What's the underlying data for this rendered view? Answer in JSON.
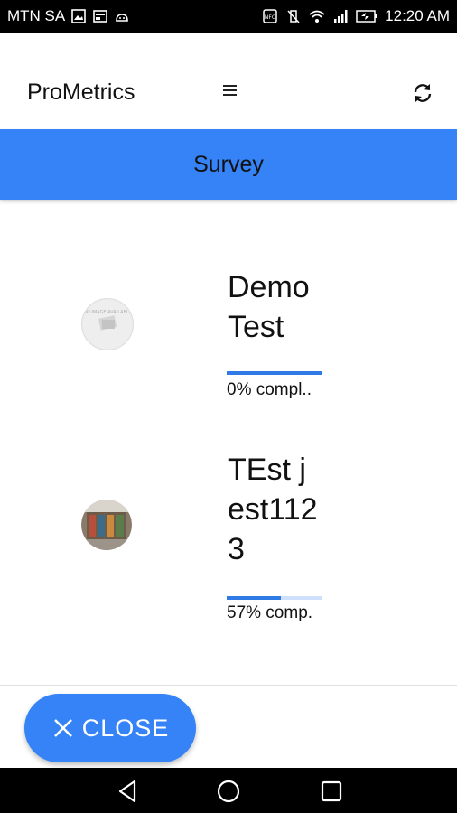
{
  "status_bar": {
    "carrier": "MTN SA",
    "time": "12:20 AM"
  },
  "header": {
    "app_title": "ProMetrics",
    "menu_icon": "menu-icon",
    "refresh_icon": "refresh-icon"
  },
  "banner": {
    "title": "Survey"
  },
  "surveys": [
    {
      "name": "Demo Test",
      "progress_percent": 0,
      "progress_label": "0% compl..",
      "thumbnail": "no-image-available",
      "thumbnail_text": "NO IMAGE AVAILABLE"
    },
    {
      "name": "TEst jest1123",
      "progress_percent": 57,
      "progress_label": "57% comp.",
      "thumbnail": "store-photo"
    }
  ],
  "bottom": {
    "close_label": "CLOSE",
    "close_icon": "close-icon"
  },
  "colors": {
    "primary": "#3583f6",
    "progress": "#2f7ae5"
  }
}
